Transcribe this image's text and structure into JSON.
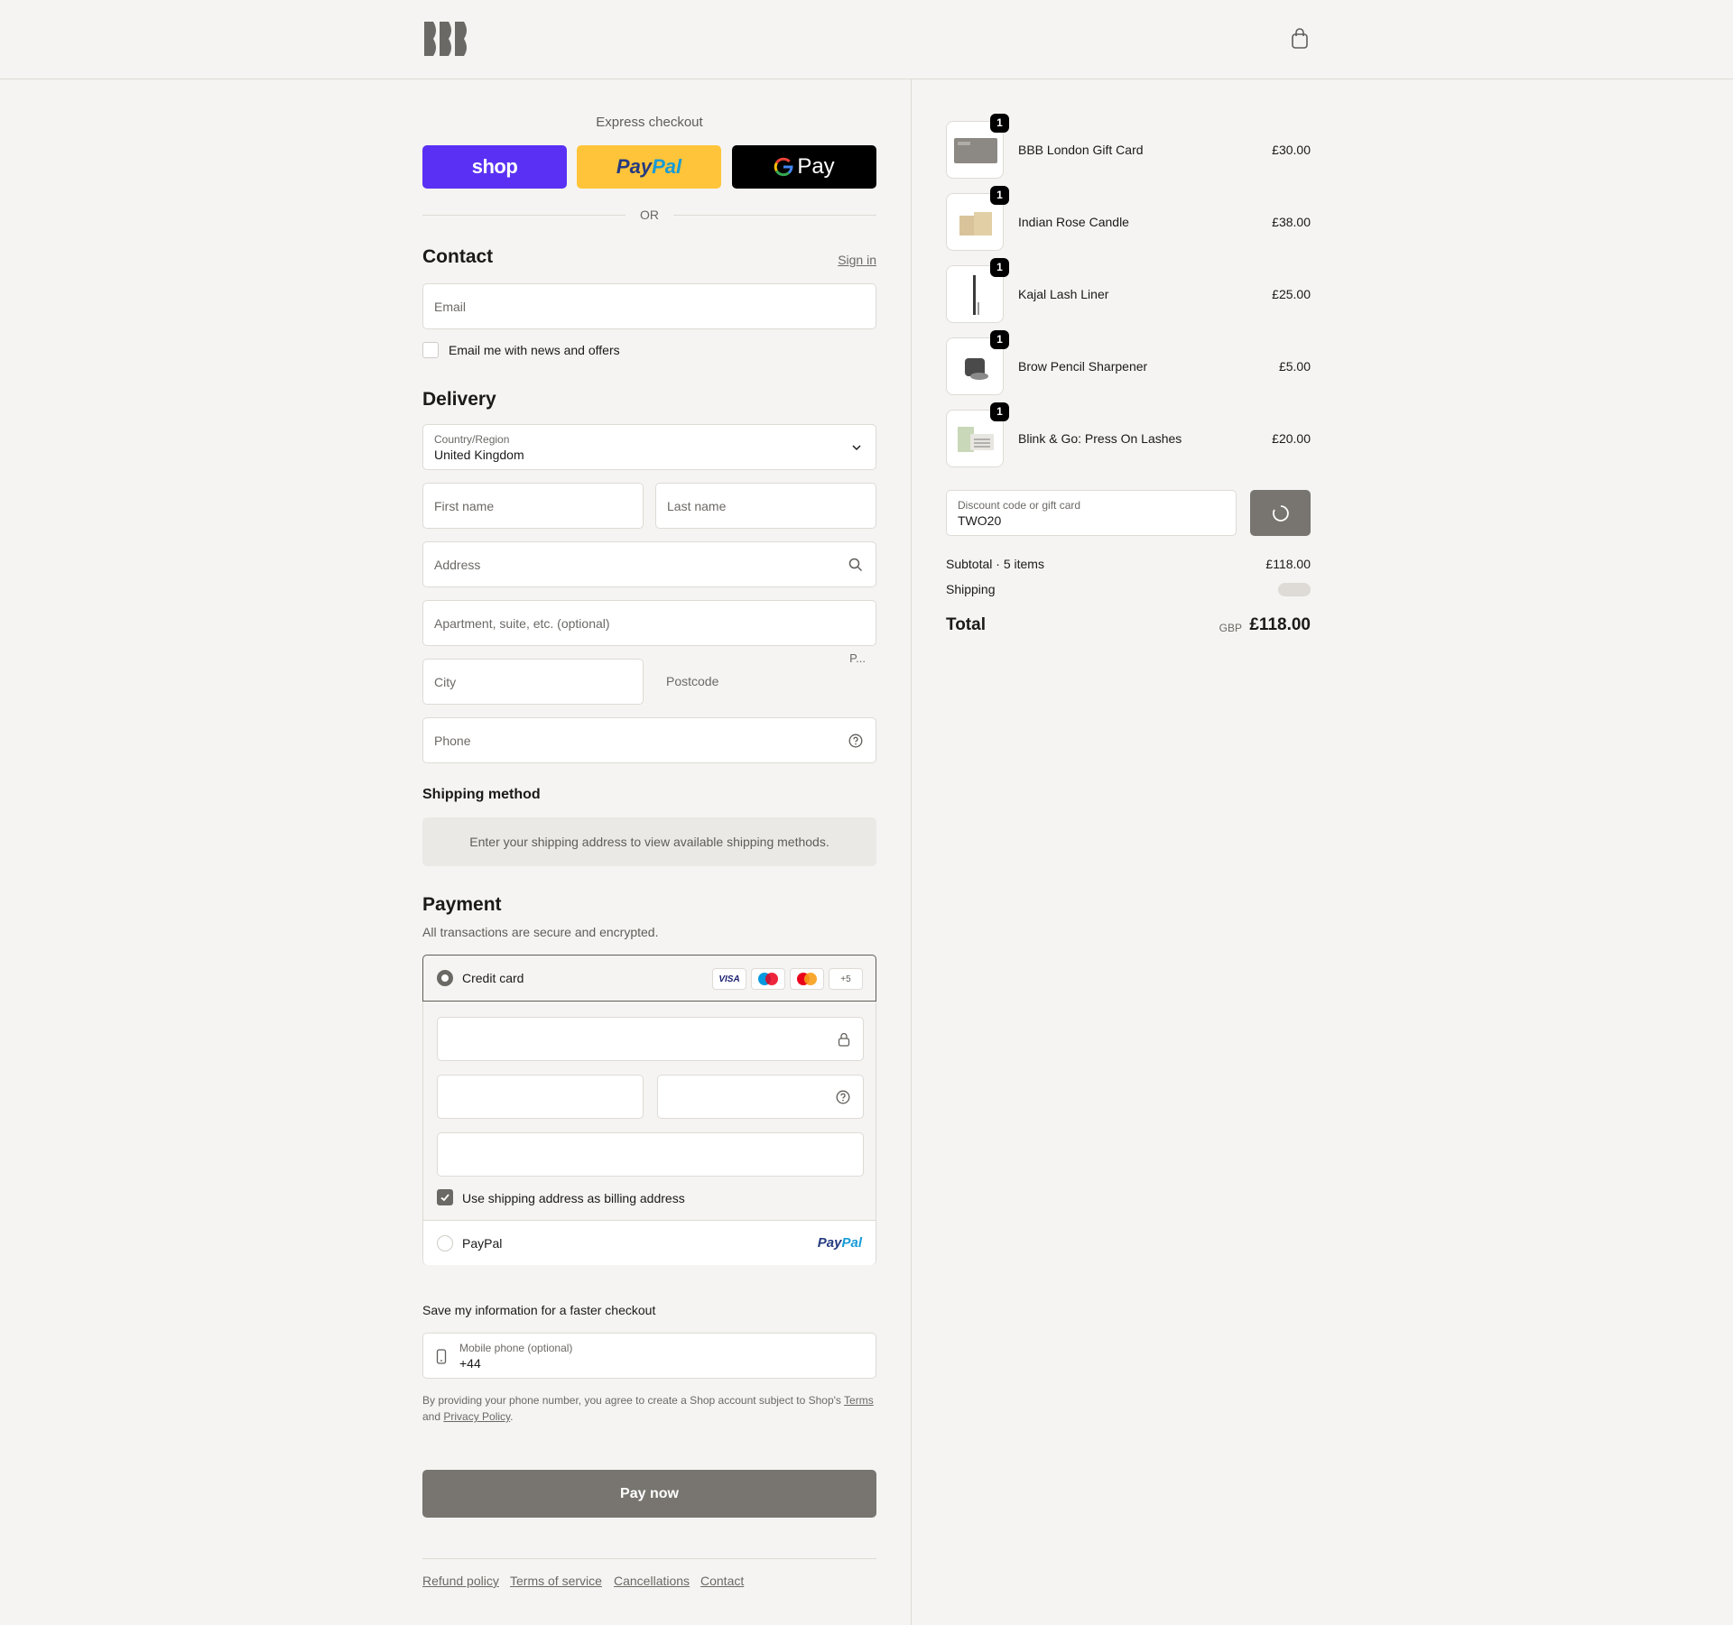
{
  "header": {
    "logo": "BBB",
    "cart_icon": "shopping-bag-icon"
  },
  "express": {
    "title": "Express checkout",
    "shop_label": "shop",
    "paypal_label_pay": "Pay",
    "paypal_label_pal": "Pal",
    "gpay_label": "Pay",
    "or": "OR"
  },
  "contact": {
    "heading": "Contact",
    "sign_in": "Sign in",
    "email_placeholder": "Email",
    "newsletter_label": "Email me with news and offers"
  },
  "delivery": {
    "heading": "Delivery",
    "country_label": "Country/Region",
    "country_value": "United Kingdom",
    "first_name": "First name",
    "last_name": "Last name",
    "address": "Address",
    "apartment": "Apartment, suite, etc. (optional)",
    "truncated_label": "P...",
    "city": "City",
    "postcode": "Postcode",
    "phone": "Phone"
  },
  "shipping_method": {
    "heading": "Shipping method",
    "notice": "Enter your shipping address to view available shipping methods."
  },
  "payment": {
    "heading": "Payment",
    "subtitle": "All transactions are secure and encrypted.",
    "credit_card_label": "Credit card",
    "brands": [
      "VISA",
      "+5"
    ],
    "billing_label": "Use shipping address as billing address",
    "paypal_label": "PayPal",
    "paypal_logo_pay": "Pay",
    "paypal_logo_pal": "Pal"
  },
  "save_info": {
    "heading": "Save my information for a faster checkout",
    "mobile_label": "Mobile phone (optional)",
    "mobile_value": "+44",
    "legal_prefix": "By providing your phone number, you agree to create a Shop account subject to Shop's",
    "terms": "Terms",
    "and": "and",
    "privacy": "Privacy Policy",
    "period": "."
  },
  "pay_now": "Pay now",
  "footer": [
    "Refund policy",
    "Terms of service",
    "Cancellations",
    "Contact"
  ],
  "cart": {
    "items": [
      {
        "name": "BBB London Gift Card",
        "price": "£30.00",
        "qty": "1"
      },
      {
        "name": "Indian Rose Candle",
        "price": "£38.00",
        "qty": "1"
      },
      {
        "name": "Kajal Lash Liner",
        "price": "£25.00",
        "qty": "1"
      },
      {
        "name": "Brow Pencil Sharpener",
        "price": "£5.00",
        "qty": "1"
      },
      {
        "name": "Blink & Go: Press On Lashes",
        "price": "£20.00",
        "qty": "1"
      }
    ],
    "discount_label": "Discount code or gift card",
    "discount_value": "TWO20",
    "subtotal_label": "Subtotal · 5 items",
    "subtotal_value": "£118.00",
    "shipping_label": "Shipping",
    "total_label": "Total",
    "currency": "GBP",
    "total_value": "£118.00"
  },
  "colors": {
    "accent": "#787570",
    "shop_purple": "#5a31f4",
    "paypal_yellow": "#ffc439",
    "background": "#f5f4f2"
  }
}
